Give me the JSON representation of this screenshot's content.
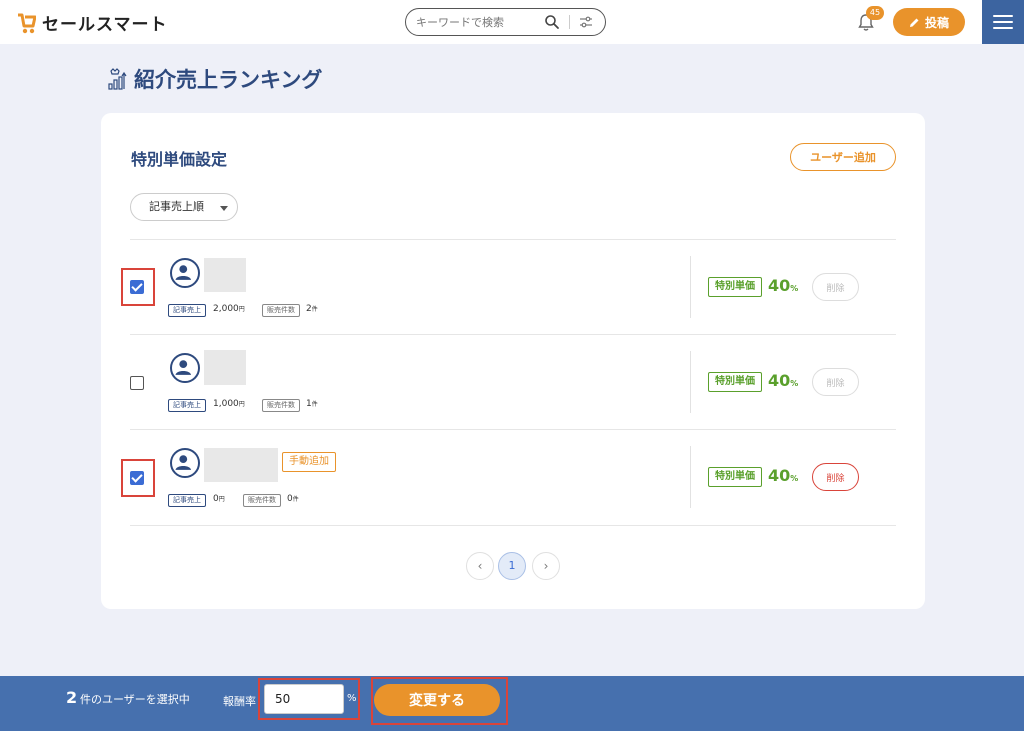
{
  "header": {
    "logo_text": "セールスマート",
    "search_placeholder": "キーワードで検索",
    "notification_count": "45",
    "post_label": "投稿"
  },
  "page": {
    "title": "紹介売上ランキング"
  },
  "card": {
    "title": "特別単価設定",
    "add_user_label": "ユーザー追加",
    "sort_label": "記事売上順"
  },
  "rows": [
    {
      "checked": true,
      "sales_label": "記事売上",
      "sales_value": "2,000",
      "sales_unit": "円",
      "count_label": "販売件数",
      "count_value": "2",
      "count_unit": "件",
      "special_label": "特別単価",
      "rate": "40",
      "rate_unit": "%",
      "delete_label": "削除"
    },
    {
      "checked": false,
      "sales_label": "記事売上",
      "sales_value": "1,000",
      "sales_unit": "円",
      "count_label": "販売件数",
      "count_value": "1",
      "count_unit": "件",
      "special_label": "特別単価",
      "rate": "40",
      "rate_unit": "%",
      "delete_label": "削除"
    },
    {
      "checked": true,
      "manual_tag": "手動追加",
      "sales_label": "記事売上",
      "sales_value": "0",
      "sales_unit": "円",
      "count_label": "販売件数",
      "count_value": "0",
      "count_unit": "件",
      "special_label": "特別単価",
      "rate": "40",
      "rate_unit": "%",
      "delete_label": "削除"
    }
  ],
  "pagination": {
    "prev": "‹",
    "current": "1",
    "next": "›"
  },
  "bottom": {
    "selected_count": "2",
    "selected_text": "件のユーザーを選択中",
    "rate_label": "報酬率",
    "rate_value": "50",
    "percent": "%",
    "change_label": "変更する"
  },
  "colors": {
    "accent": "#e9932b",
    "primary": "#2e4a7e",
    "bar": "#4670ae",
    "green": "#5aa02c",
    "danger": "#d9443a"
  }
}
